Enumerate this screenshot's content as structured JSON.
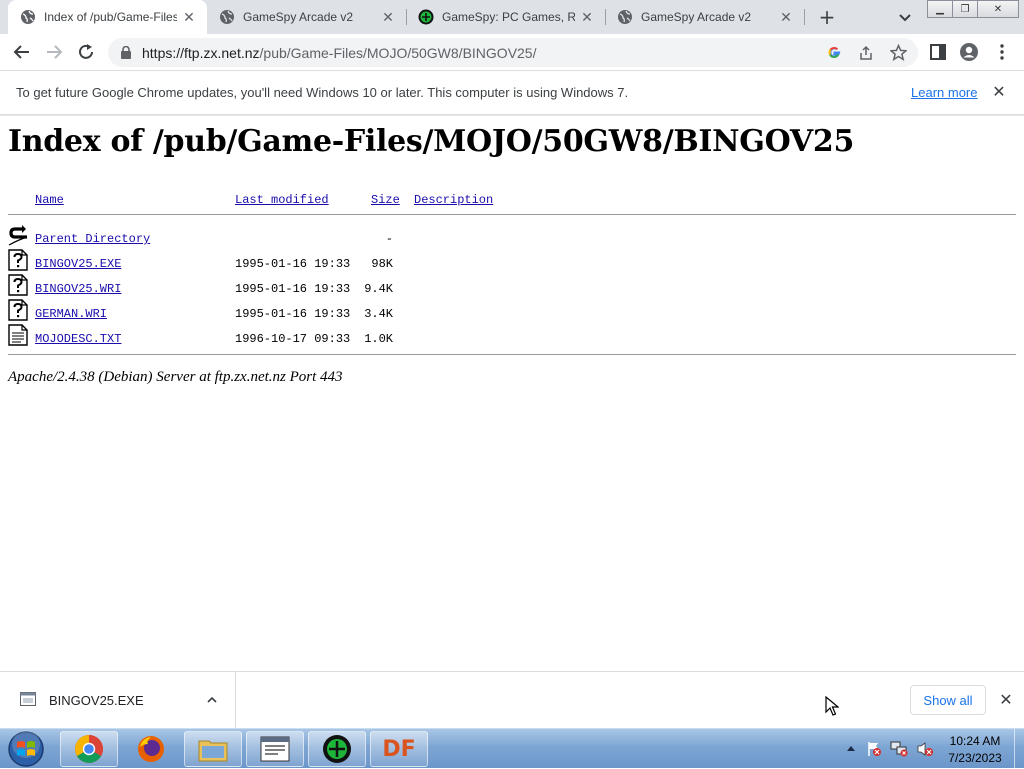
{
  "browser": {
    "tabs": [
      {
        "title": "Index of /pub/Game-Files/",
        "icon": "globe-icon",
        "active": true
      },
      {
        "title": "GameSpy Arcade v2",
        "icon": "globe-icon",
        "active": false
      },
      {
        "title": "GameSpy: PC Games, Rev",
        "icon": "gamespy-icon",
        "active": false
      },
      {
        "title": "GameSpy Arcade v2",
        "icon": "globe-icon",
        "active": false
      }
    ],
    "url_host": "https://ftp.zx.net.nz",
    "url_path": "/pub/Game-Files/MOJO/50GW8/BINGOV25/"
  },
  "infobar": {
    "message": "To get future Google Chrome updates, you'll need Windows 10 or later. This computer is using Windows 7.",
    "link": "Learn more"
  },
  "listing": {
    "title": "Index of /pub/Game-Files/MOJO/50GW8/BINGOV25",
    "columns": {
      "name": "Name",
      "modified": "Last modified",
      "size": "Size",
      "description": "Description"
    },
    "parent": {
      "name": "Parent Directory",
      "size": "-"
    },
    "files": [
      {
        "name": "BINGOV25.EXE",
        "modified": "1995-01-16 19:33",
        "size": "98K",
        "icon": "unknown-file-icon"
      },
      {
        "name": "BINGOV25.WRI",
        "modified": "1995-01-16 19:33",
        "size": "9.4K",
        "icon": "unknown-file-icon"
      },
      {
        "name": "GERMAN.WRI",
        "modified": "1995-01-16 19:33",
        "size": "3.4K",
        "icon": "unknown-file-icon"
      },
      {
        "name": "MOJODESC.TXT",
        "modified": "1996-10-17 09:33",
        "size": "1.0K",
        "icon": "text-file-icon"
      }
    ],
    "server_signature": "Apache/2.4.38 (Debian) Server at ftp.zx.net.nz Port 443"
  },
  "download_shelf": {
    "file_name": "BINGOV25.EXE",
    "show_all": "Show all"
  },
  "taskbar": {
    "apps": [
      "chrome",
      "firefox",
      "file-explorer",
      "notepad-window",
      "gamespy",
      "df"
    ],
    "df_label": "DF",
    "time": "10:24 AM",
    "date": "7/23/2023"
  }
}
